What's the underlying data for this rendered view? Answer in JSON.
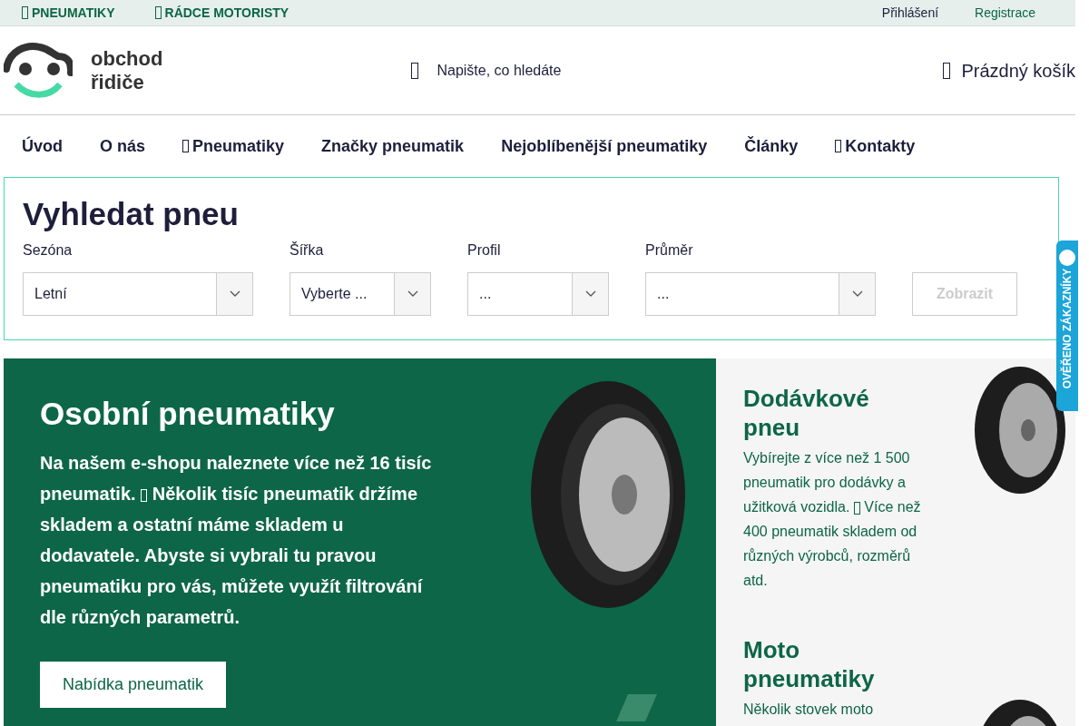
{
  "top_bar": {
    "left_links": [
      {
        "label": "PNEUMATIKY",
        "has_icon": true
      },
      {
        "label": "RÁDCE MOTORISTY",
        "has_icon": true
      }
    ],
    "right_links": [
      {
        "label": "Přihlášení",
        "kind": "plain"
      },
      {
        "label": "Registrace",
        "kind": "accent"
      }
    ]
  },
  "header": {
    "logo_text": [
      "obchod",
      "řidiče"
    ],
    "search": {
      "placeholder": "Napište, co hledáte"
    },
    "cart": "Prázdný košík"
  },
  "nav": [
    {
      "label": "Úvod",
      "has_icon": false
    },
    {
      "label": "O nás",
      "has_icon": false
    },
    {
      "label": "Pneumatiky",
      "has_icon": true
    },
    {
      "label": "Značky pneumatik",
      "has_icon": false
    },
    {
      "label": "Nejoblíbenější pneumatiky",
      "has_icon": false
    },
    {
      "label": "Články",
      "has_icon": false
    },
    {
      "label": "Kontakty",
      "has_icon": true
    }
  ],
  "tire_search": {
    "title": "Vyhledat pneu",
    "fields": [
      {
        "label": "Sezóna",
        "value": "Letní"
      },
      {
        "label": "Šířka",
        "value": "Vyberte ..."
      },
      {
        "label": "Profil",
        "value": "..."
      },
      {
        "label": "Průměr",
        "value": "..."
      }
    ],
    "button": {
      "label": "Zobrazit",
      "disabled": true
    }
  },
  "hero": {
    "title": "Osobní pneumatiky",
    "text_parts": [
      "Na našem e-shopu naleznete více než 16 tisíc pneumatik.",
      "Několik tisíc pneumatik držíme skladem a ostatní máme skladem u dodavatele. Abyste si vybrali tu pravou pneumatiku pro vás, můžete využít filtrování dle různých parametrů."
    ],
    "button": "Nabídka pneumatik"
  },
  "side_cards": [
    {
      "title": "Dodávkové pneu",
      "text_parts": [
        "Vybírejte z více než 1 500 pneumatik pro dodávky a užitková vozidla.",
        "Více než 400 pneumatik skladem od různých výrobců, rozměrů atd."
      ]
    },
    {
      "title": "Moto pneumatiky",
      "text_parts": [
        "Několik stovek moto"
      ]
    }
  ],
  "badge": "OVĚŘENO ZÁKAZNÍKY"
}
